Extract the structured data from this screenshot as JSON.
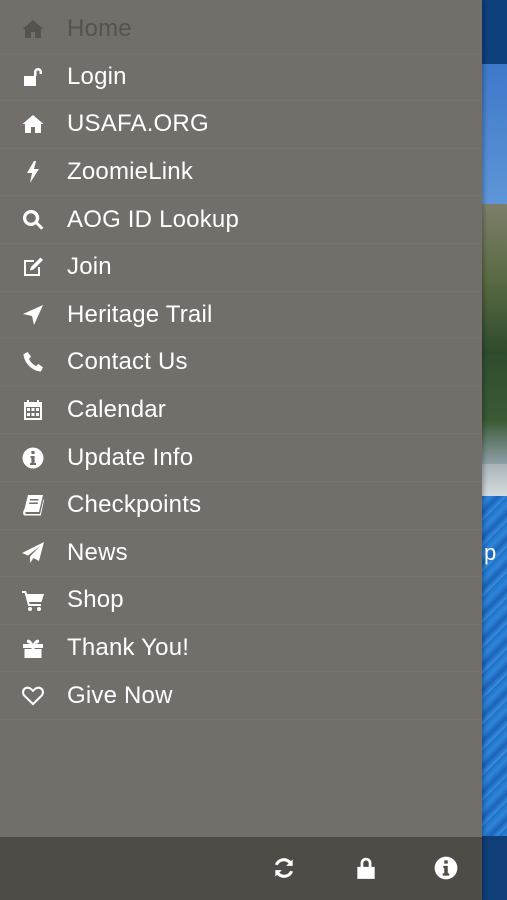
{
  "menu": {
    "items": [
      {
        "label": "Home",
        "icon": "home-icon",
        "disabled": true
      },
      {
        "label": "Login",
        "icon": "unlock-icon"
      },
      {
        "label": "USAFA.ORG",
        "icon": "home-icon"
      },
      {
        "label": "ZoomieLink",
        "icon": "lightning-icon"
      },
      {
        "label": "AOG ID Lookup",
        "icon": "search-icon"
      },
      {
        "label": "Join",
        "icon": "edit-icon"
      },
      {
        "label": "Heritage Trail",
        "icon": "location-arrow-icon"
      },
      {
        "label": "Contact Us",
        "icon": "phone-icon"
      },
      {
        "label": "Calendar",
        "icon": "calendar-icon"
      },
      {
        "label": "Update Info",
        "icon": "info-circle-icon"
      },
      {
        "label": "Checkpoints",
        "icon": "book-icon"
      },
      {
        "label": "News",
        "icon": "paper-plane-icon"
      },
      {
        "label": "Shop",
        "icon": "cart-icon"
      },
      {
        "label": "Thank You!",
        "icon": "gift-icon"
      },
      {
        "label": "Give Now",
        "icon": "heart-icon"
      }
    ]
  },
  "footer": {
    "buttons": [
      "refresh-icon",
      "lock-icon",
      "info-icon"
    ]
  },
  "background": {
    "partial_text": "p"
  },
  "colors": {
    "drawer": "#726e69",
    "footer": "#4f4b47",
    "disabled_text": "#56524e",
    "text": "#ffffff"
  }
}
